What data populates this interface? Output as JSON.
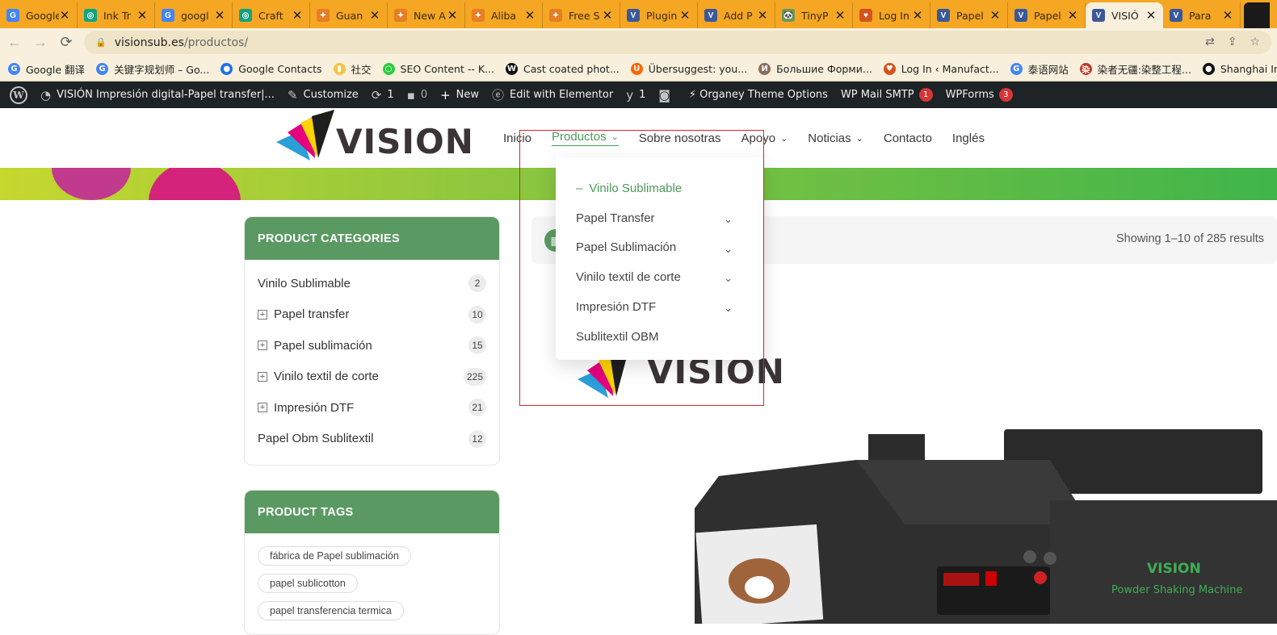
{
  "browser": {
    "tabs": [
      {
        "title": "Google",
        "favicon_color": "#4285f4",
        "favicon_glyph": "G"
      },
      {
        "title": "Ink Tr",
        "favicon_color": "#10a37f",
        "favicon_glyph": "◎"
      },
      {
        "title": "googl",
        "favicon_color": "#4285f4",
        "favicon_glyph": "G"
      },
      {
        "title": "Craft",
        "favicon_color": "#10a37f",
        "favicon_glyph": "◎"
      },
      {
        "title": "Guan",
        "favicon_color": "#e67e22",
        "favicon_glyph": "✦"
      },
      {
        "title": "New A",
        "favicon_color": "#e67e22",
        "favicon_glyph": "✦"
      },
      {
        "title": "Aliba",
        "favicon_color": "#e67e22",
        "favicon_glyph": "✦"
      },
      {
        "title": "Free S",
        "favicon_color": "#e67e22",
        "favicon_glyph": "✦"
      },
      {
        "title": "Plugin",
        "favicon_color": "#3b5998",
        "favicon_glyph": "V"
      },
      {
        "title": "Add P",
        "favicon_color": "#3b5998",
        "favicon_glyph": "V"
      },
      {
        "title": "TinyP",
        "favicon_color": "#6a9955",
        "favicon_glyph": "🐼"
      },
      {
        "title": "Log In",
        "favicon_color": "#d4531c",
        "favicon_glyph": "♥"
      },
      {
        "title": "Papel",
        "favicon_color": "#3b5998",
        "favicon_glyph": "V"
      },
      {
        "title": "Papel",
        "favicon_color": "#3b5998",
        "favicon_glyph": "V"
      },
      {
        "title": "VISIÓ",
        "favicon_color": "#3b5998",
        "favicon_glyph": "V",
        "active": true
      },
      {
        "title": "Para",
        "favicon_color": "#3b5998",
        "favicon_glyph": "V"
      }
    ],
    "url_host": "visionsub.es",
    "url_path": "/productos/",
    "bookmarks": [
      {
        "label": "Google 翻译",
        "icon_color": "#4285f4",
        "glyph": "G"
      },
      {
        "label": "关键字规划师 – Go...",
        "icon_color": "#4285f4",
        "glyph": "G"
      },
      {
        "label": "Google Contacts",
        "icon_color": "#1a73e8",
        "glyph": "●"
      },
      {
        "label": "社交",
        "icon_color": "#f4c542",
        "glyph": "▮"
      },
      {
        "label": "SEO Content -- K...",
        "icon_color": "#2ecc40",
        "glyph": "○"
      },
      {
        "label": "Cast coated phot...",
        "icon_color": "#111111",
        "glyph": "W"
      },
      {
        "label": "Übersuggest: you...",
        "icon_color": "#ff6600",
        "glyph": "U"
      },
      {
        "label": "Большие Форми...",
        "icon_color": "#8a6d5b",
        "glyph": "И"
      },
      {
        "label": "Log In ‹ Manufact...",
        "icon_color": "#d4531c",
        "glyph": "♥"
      },
      {
        "label": "泰语网站",
        "icon_color": "#4285f4",
        "glyph": "G"
      },
      {
        "label": "染者无疆:染整工程...",
        "icon_color": "#c0392b",
        "glyph": "染"
      },
      {
        "label": "Shanghai Int'l Ad...",
        "icon_color": "#111111",
        "glyph": "●"
      }
    ]
  },
  "adminbar": {
    "site_name": "VISIÓN Impresión digital-Papel transfer|...",
    "customize": "Customize",
    "updates": "1",
    "comments": "0",
    "new": "New",
    "elementor": "Edit with Elementor",
    "yoast_count": "1",
    "organey": "⚡ Organey Theme Options",
    "wp_mail": "WP Mail SMTP",
    "wp_mail_badge": "1",
    "wpforms": "WPForms",
    "wpforms_badge": "3"
  },
  "site": {
    "logo_text": "VISION",
    "nav": [
      "Inicio",
      "Productos",
      "Sobre nosotras",
      "Apoyo",
      "Noticias",
      "Contacto",
      "Inglés"
    ],
    "dropdown": [
      {
        "label": "Vinilo Sublimable",
        "active": true
      },
      {
        "label": "Papel Transfer",
        "has_children": true
      },
      {
        "label": "Papel Sublimación",
        "has_children": true
      },
      {
        "label": "Vinilo textil de corte",
        "has_children": true
      },
      {
        "label": "Impresión DTF",
        "has_children": true
      },
      {
        "label": "Sublitextil OBM"
      }
    ],
    "categories_title": "PRODUCT CATEGORIES",
    "categories": [
      {
        "label": "Vinilo Sublimable",
        "count": "2",
        "expandable": false
      },
      {
        "label": "Papel transfer",
        "count": "10",
        "expandable": true
      },
      {
        "label": "Papel sublimación",
        "count": "15",
        "expandable": true
      },
      {
        "label": "Vinilo textil de corte",
        "count": "225",
        "expandable": true
      },
      {
        "label": "Impresión DTF",
        "count": "21",
        "expandable": true
      },
      {
        "label": "Papel Obm Sublitextil",
        "count": "12",
        "expandable": false
      }
    ],
    "tags_title": "PRODUCT TAGS",
    "tags": [
      "fábrica de Papel sublimación",
      "papel sublicotton",
      "papel transferencia termica"
    ],
    "results": "Showing 1–10 of 285 results",
    "product_logo_text": "VISION",
    "machine_label": "VISION",
    "machine_sublabel": "Powder Shaking Machine"
  }
}
